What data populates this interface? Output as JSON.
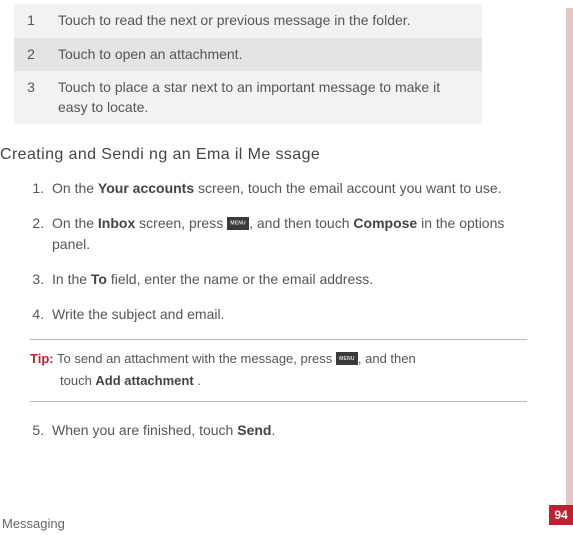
{
  "table": {
    "rows": [
      {
        "num": "1",
        "text": "Touch to read the next or previous message in the folder."
      },
      {
        "num": "2",
        "text": "Touch to open an attachment."
      },
      {
        "num": "3",
        "text": "Touch to place a star next to an important message to make it easy to locate."
      }
    ]
  },
  "heading": "Creating and Sendi ng an Ema il Me ssage",
  "steps": {
    "s1_a": "On the ",
    "s1_b": "Your accounts",
    "s1_c": " screen, touch the email account you want to use.",
    "s2_a": "On the ",
    "s2_b": "Inbox",
    "s2_c": " screen, press ",
    "s2_d": ", and then touch ",
    "s2_e": "Compose",
    "s2_f": " in the options panel.",
    "s3_a": "In the ",
    "s3_b": "To",
    "s3_c": " field, enter the name or the email address.",
    "s4": "Write the subject and email.",
    "tip_label": "Tip:",
    "tip_a": "  To send an attachment with the message,  press ",
    "tip_b": ", and then",
    "tip_c": "touch ",
    "tip_d": "Add attachment",
    "tip_e": " .",
    "s5_a": "When you are finished, touch ",
    "s5_b": "Send",
    "s5_c": "."
  },
  "footer": "Messaging",
  "page_number": "94"
}
